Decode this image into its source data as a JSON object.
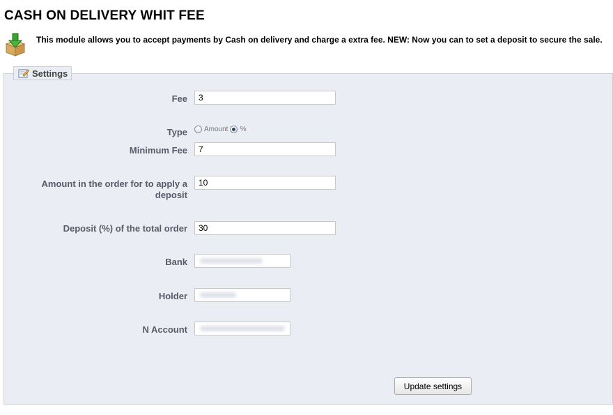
{
  "page": {
    "title": "CASH ON DELIVERY WHIT FEE",
    "description": "This module allows you to accept payments by Cash on delivery and charge a extra fee. NEW: Now you can to set a deposit to secure the sale.",
    "icon": "box-download-icon"
  },
  "settings": {
    "legend": "Settings",
    "legend_icon": "edit-settings-icon",
    "fee": {
      "label": "Fee",
      "value": "3"
    },
    "type": {
      "label": "Type",
      "options": [
        "Amount",
        "%"
      ],
      "selected": "%"
    },
    "minimum_fee": {
      "label": "Minimum Fee",
      "value": "7"
    },
    "deposit_amount": {
      "label": "Amount in the order for to apply a deposit",
      "value": "10"
    },
    "deposit_percent": {
      "label": "Deposit (%) of the total order",
      "value": "30"
    },
    "bank": {
      "label": "Bank"
    },
    "holder": {
      "label": "Holder"
    },
    "account": {
      "label": "N Account"
    },
    "submit_label": "Update settings"
  }
}
